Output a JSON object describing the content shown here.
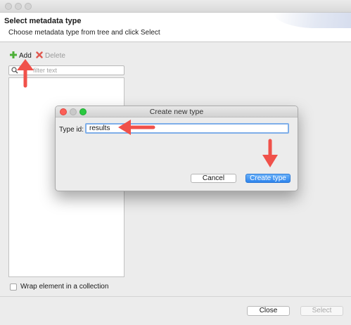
{
  "window": {
    "header_title": "Select metadata type",
    "header_subtitle": "Choose metadata type from tree and click Select"
  },
  "toolbar": {
    "add_label": "Add",
    "delete_label": "Delete"
  },
  "filter": {
    "placeholder": "filter text"
  },
  "options": {
    "wrap_label": "Wrap element in a collection",
    "wrap_checked": false
  },
  "footer": {
    "close_label": "Close",
    "select_label": "Select"
  },
  "dialog": {
    "title": "Create new type",
    "type_id_label": "Type id:",
    "type_id_value": "results",
    "cancel_label": "Cancel",
    "create_label": "Create type"
  },
  "icons": {
    "add": "plus-icon",
    "delete": "x-icon",
    "search": "magnifier-icon"
  },
  "colors": {
    "accent_blue": "#2d84ec",
    "close_red": "#fc5f57",
    "minimize_yellow": "#c9c9c9",
    "zoom_green": "#2ac940",
    "annotation_red": "#f0514a",
    "add_green": "#4caf37",
    "delete_red": "#e0584f"
  }
}
